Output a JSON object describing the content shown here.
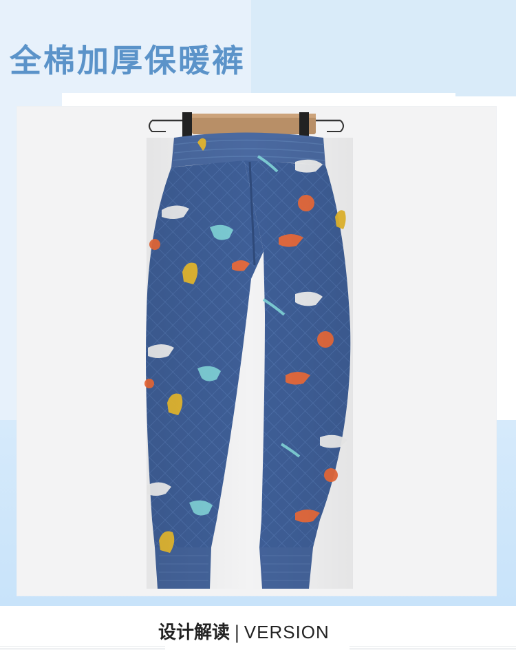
{
  "headline": "全棉加厚保暖裤",
  "footer": {
    "title_cn": "设计解读",
    "separator": "|",
    "title_en": "VERSION"
  },
  "colors": {
    "headline": "#5b93c9",
    "pants": "#3f5f97",
    "background_blue": "#d6eafb"
  },
  "photo": {
    "subject": "pants-photo"
  }
}
